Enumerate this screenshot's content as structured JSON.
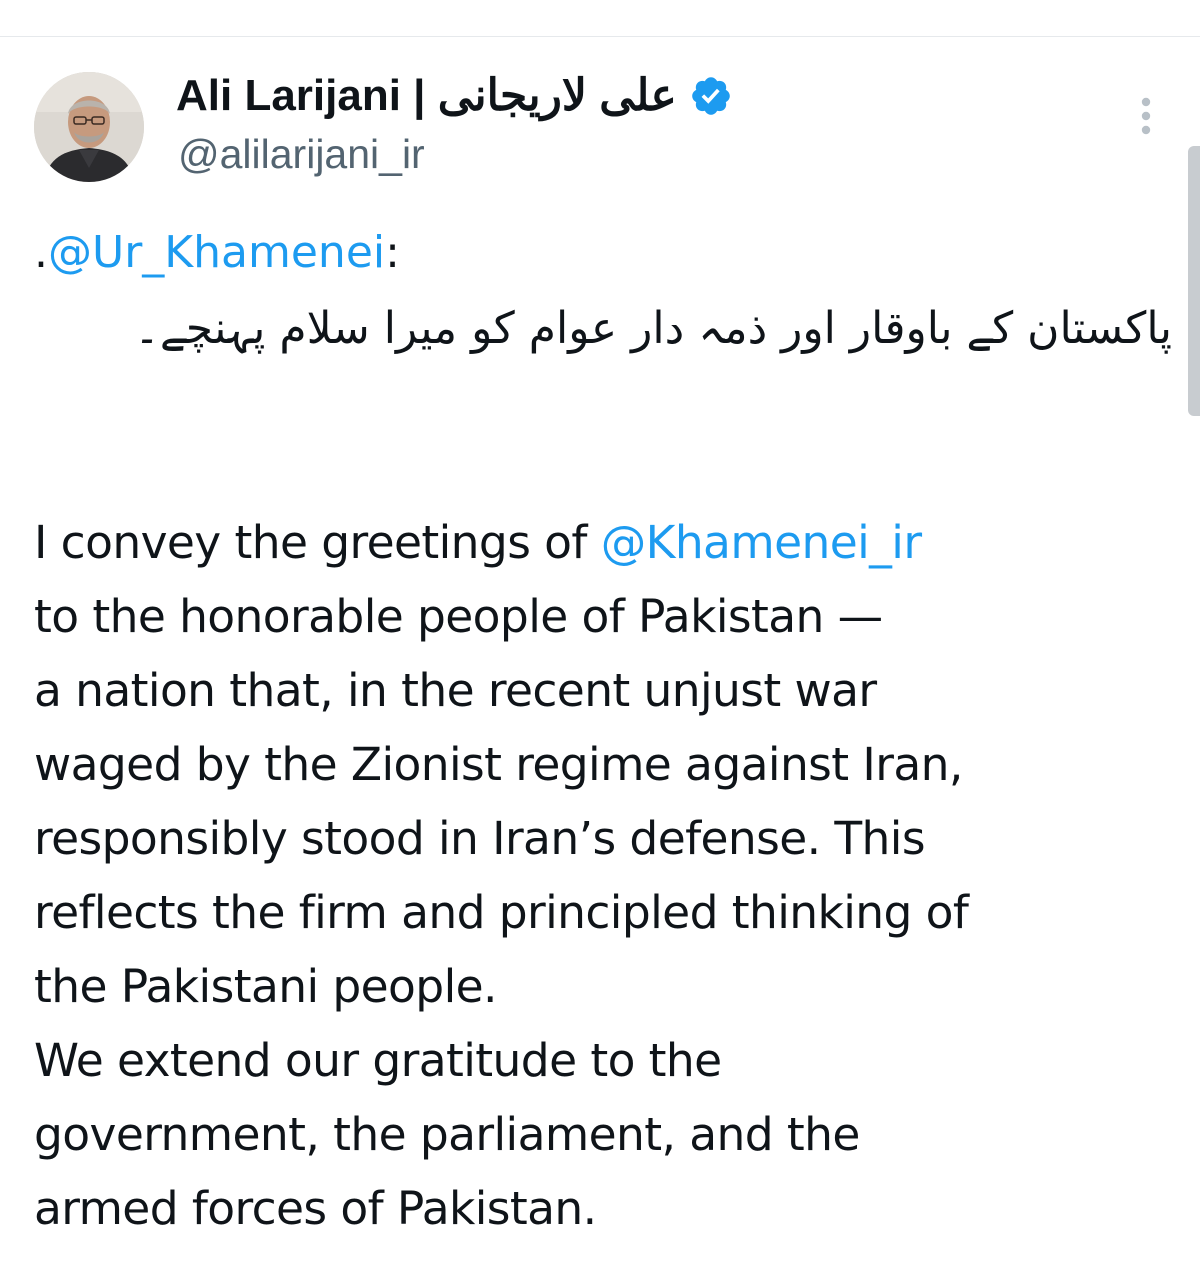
{
  "tweet": {
    "author": {
      "display_name": "Ali Larijani | علی لاریجانی",
      "handle": "@alilarijani_ir",
      "verified_icon": "verified-badge-icon",
      "avatar": "profile-photo"
    },
    "menu_icon": "more-options-icon",
    "body": {
      "prefix": ".",
      "quoted_mention": "@Ur_Khamenei",
      "colon": ":",
      "urdu_text": "پاکستان کے باوقار اور ذمہ دار عوام کو میرا سلام پہنچے۔",
      "english_line_1_before": "I convey the greetings of ",
      "english_mention": "@Khamenei_ir",
      "english_lines": [
        "to the honorable people of Pakistan —",
        "a nation that, in the recent unjust war",
        "waged by the Zionist regime against Iran,",
        "responsibly stood in Iran’s defense. This",
        "reflects the firm and principled thinking of",
        "the Pakistani people.",
        "We extend our gratitude to the",
        "government, the parliament, and the",
        "armed forces of Pakistan."
      ]
    },
    "colors": {
      "link": "#1d9bf0",
      "text": "#0f1419",
      "secondary": "#536471"
    }
  }
}
